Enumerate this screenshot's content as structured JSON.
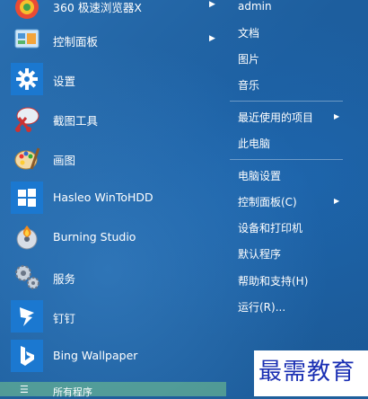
{
  "left_menu": {
    "items": [
      {
        "label": "360 极速浏览器X",
        "icon": "browser-icon",
        "has_arrow": true
      },
      {
        "label": "控制面板",
        "icon": "control-panel-icon",
        "has_arrow": true
      },
      {
        "label": "设置",
        "icon": "settings-gear-icon",
        "has_arrow": false
      },
      {
        "label": "截图工具",
        "icon": "snipping-tool-icon",
        "has_arrow": false
      },
      {
        "label": "画图",
        "icon": "paint-icon",
        "has_arrow": false
      },
      {
        "label": "Hasleo WinToHDD",
        "icon": "windows-logo-icon",
        "has_arrow": false
      },
      {
        "label": "Burning Studio",
        "icon": "burning-studio-icon",
        "has_arrow": false
      },
      {
        "label": "服务",
        "icon": "services-gears-icon",
        "has_arrow": false
      },
      {
        "label": "钉钉",
        "icon": "dingtalk-icon",
        "has_arrow": false
      },
      {
        "label": "Bing Wallpaper",
        "icon": "bing-icon",
        "has_arrow": false
      }
    ],
    "all_programs": "所有程序"
  },
  "right_menu": {
    "items": [
      {
        "label": "admin"
      },
      {
        "label": "文档"
      },
      {
        "label": "图片"
      },
      {
        "label": "音乐"
      },
      {
        "label": "最近使用的项目",
        "has_arrow": true
      },
      {
        "label": "此电脑"
      },
      {
        "label": "电脑设置"
      },
      {
        "label": "控制面板(C)",
        "has_arrow": true
      },
      {
        "label": "设备和打印机"
      },
      {
        "label": "默认程序"
      },
      {
        "label": "帮助和支持(H)"
      },
      {
        "label": "运行(R)..."
      }
    ]
  },
  "watermark": "最需教育",
  "colors": {
    "background": "#1f5f9c",
    "all_programs_bar": "#78c88c",
    "watermark_text": "#1a2fb3"
  }
}
